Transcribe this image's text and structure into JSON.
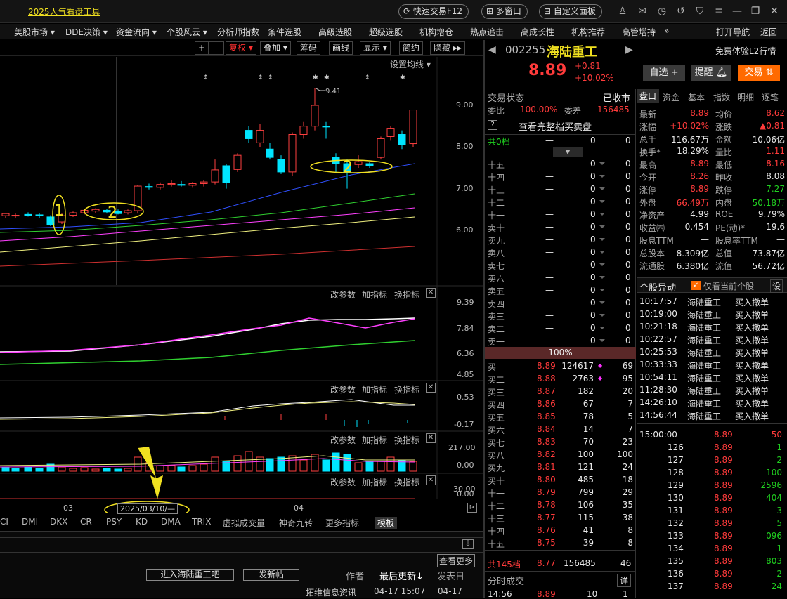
{
  "app": {
    "title_link": "2025人气看盘工具",
    "quick_trade": "快速交易F12",
    "multi_window": "多窗口",
    "custom_panel": "自定义面板"
  },
  "menu": [
    "美股市场 ▾",
    "DDE决策 ▾",
    "资金流向 ▾",
    "个股风云 ▾",
    "分析师指数",
    "条件选股",
    "高级选股",
    "超级选股",
    "机构增仓",
    "热点追击",
    "高成长性",
    "机构推荐",
    "高管增持",
    "»",
    "打开导航",
    "返回"
  ],
  "toolbar": {
    "plus": "+",
    "minus": "—",
    "fuquan": "复权 ▾",
    "overlay": "叠加 ▾",
    "chouma": "筹码",
    "draw": "画线",
    "show": "显示 ▾",
    "simple": "简约",
    "hide": "隐藏 ▸▸"
  },
  "chart": {
    "ma_setting": "设置均线 ▾",
    "high_label": "9.41",
    "price_ticks": [
      "9.00",
      "8.00",
      "7.00",
      "6.00"
    ],
    "marks": [
      "1",
      "2",
      "2"
    ],
    "ind1": {
      "ticks": [
        "9.39",
        "7.84",
        "6.36",
        "4.85"
      ]
    },
    "ind2": {
      "ticks": [
        "0.53",
        "-0.17"
      ]
    },
    "ind3": {
      "ticks": [
        "217.00",
        "0.00"
      ]
    },
    "ind4": {
      "ticks": [
        "30.00",
        "0.00"
      ]
    },
    "controls": {
      "params": "改参数",
      "add": "加指标",
      "swap": "换指标"
    },
    "dates": {
      "m1": "03",
      "m2": "04",
      "cursor": "2025/03/10/—"
    }
  },
  "indicator_tabs": [
    "CI",
    "DMI",
    "DKX",
    "CR",
    "PSY",
    "KD",
    "DMA",
    "TRIX",
    "虚拟成交量",
    "神奇九转",
    "更多指标",
    "模板"
  ],
  "bottom": {
    "more": "查看更多",
    "forum_btn": "进入海陆重工吧",
    "post_btn": "发新帖",
    "author_col": "作者",
    "last_update": "最后更新↓",
    "reply_col": "发表日",
    "source": "拓维信息资讯",
    "time": "04-17 15:07",
    "date": "04-17"
  },
  "stock": {
    "code": "002255",
    "name": "海陆重工",
    "price": "8.89",
    "change": "+0.81",
    "pct": "+10.02%",
    "l2": "免费体验L2行情",
    "btn_watch": "自选 +",
    "btn_alert": "提醒",
    "btn_trade": "交易"
  },
  "status": {
    "label": "交易状态",
    "value": "已收市",
    "weibi_label": "委比",
    "weibi": "100.00%",
    "weicha_label": "委差",
    "weicha": "156485",
    "full": "查看完整档买卖盘",
    "q": "?"
  },
  "sell_head": {
    "label": "共0档",
    "dash": "—",
    "v1": "0",
    "v2": "0"
  },
  "sells": [
    [
      "十五",
      "—",
      "0",
      "0"
    ],
    [
      "十四",
      "—",
      "0",
      "0"
    ],
    [
      "十三",
      "—",
      "0",
      "0"
    ],
    [
      "十二",
      "—",
      "0",
      "0"
    ],
    [
      "十一",
      "—",
      "0",
      "0"
    ],
    [
      "卖十",
      "—",
      "0",
      "0"
    ],
    [
      "卖九",
      "—",
      "0",
      "0"
    ],
    [
      "卖八",
      "—",
      "0",
      "0"
    ],
    [
      "卖七",
      "—",
      "0",
      "0"
    ],
    [
      "卖六",
      "—",
      "0",
      "0"
    ],
    [
      "卖五",
      "—",
      "0",
      "0"
    ],
    [
      "卖四",
      "—",
      "0",
      "0"
    ],
    [
      "卖三",
      "—",
      "0",
      "0"
    ],
    [
      "卖二",
      "—",
      "0",
      "0"
    ],
    [
      "卖一",
      "—",
      "0",
      "0"
    ]
  ],
  "ratio": "100%",
  "buys": [
    [
      "买一",
      "8.89",
      "124617",
      "69"
    ],
    [
      "买二",
      "8.88",
      "2763",
      "95"
    ],
    [
      "买三",
      "8.87",
      "182",
      "20"
    ],
    [
      "买四",
      "8.86",
      "67",
      "7"
    ],
    [
      "买五",
      "8.85",
      "78",
      "5"
    ],
    [
      "买六",
      "8.84",
      "14",
      "7"
    ],
    [
      "买七",
      "8.83",
      "70",
      "23"
    ],
    [
      "买八",
      "8.82",
      "100",
      "100"
    ],
    [
      "买九",
      "8.81",
      "121",
      "24"
    ],
    [
      "买十",
      "8.80",
      "485",
      "18"
    ],
    [
      "十一",
      "8.79",
      "799",
      "29"
    ],
    [
      "十二",
      "8.78",
      "106",
      "35"
    ],
    [
      "十三",
      "8.77",
      "115",
      "38"
    ],
    [
      "十四",
      "8.76",
      "41",
      "8"
    ],
    [
      "十五",
      "8.75",
      "39",
      "8"
    ]
  ],
  "buy_total": {
    "label": "共145档",
    "price": "8.77",
    "vol": "156485",
    "n": "46"
  },
  "ticks_head": {
    "label": "分时成交",
    "more": "详"
  },
  "tick_rows": [
    [
      "14:56",
      "8.89",
      "10",
      "1"
    ]
  ],
  "tabs": [
    "盘口",
    "资金",
    "基本",
    "指数",
    "明细",
    "逐笔"
  ],
  "quote": [
    [
      "最新",
      "8.89",
      "均价",
      "8.62"
    ],
    [
      "涨幅",
      "+10.02%",
      "涨跌",
      "▲0.81"
    ],
    [
      "总手",
      "116.67万",
      "金额",
      "10.06亿"
    ],
    [
      "换手*",
      "18.29%",
      "量比",
      "1.11"
    ],
    [
      "最高",
      "8.89",
      "最低",
      "8.16"
    ],
    [
      "今开",
      "8.26",
      "昨收",
      "8.08"
    ],
    [
      "涨停",
      "8.89",
      "跌停",
      "7.27"
    ],
    [
      "外盘",
      "66.49万",
      "内盘",
      "50.18万"
    ],
    [
      "净资产",
      "4.99",
      "ROE",
      "9.79%"
    ],
    [
      "收益㈣",
      "0.454",
      "PE(动)*",
      "19.6"
    ],
    [
      "股息TTM",
      "—",
      "股息率TTM",
      "—"
    ],
    [
      "总股本",
      "8.309亿",
      "总值",
      "73.87亿"
    ],
    [
      "流通股",
      "6.380亿",
      "流值",
      "56.72亿"
    ]
  ],
  "alerts": {
    "title": "个股异动",
    "only": "仅看当前个股",
    "settings": "设",
    "rows": [
      [
        "10:17:57",
        "海陆重工",
        "买入撤单"
      ],
      [
        "10:19:00",
        "海陆重工",
        "买入撤单"
      ],
      [
        "10:21:18",
        "海陆重工",
        "买入撤单"
      ],
      [
        "10:22:57",
        "海陆重工",
        "买入撤单"
      ],
      [
        "10:25:53",
        "海陆重工",
        "买入撤单"
      ],
      [
        "10:33:33",
        "海陆重工",
        "买入撤单"
      ],
      [
        "10:54:11",
        "海陆重工",
        "买入撤单"
      ],
      [
        "11:28:30",
        "海陆重工",
        "买入撤单"
      ],
      [
        "14:26:10",
        "海陆重工",
        "买入撤单"
      ],
      [
        "14:56:44",
        "海陆重工",
        "买入撤单"
      ]
    ]
  },
  "trades": [
    [
      "15:00:00",
      "8.89",
      "50"
    ],
    [
      "126",
      "8.89",
      "1"
    ],
    [
      "127",
      "8.89",
      "2"
    ],
    [
      "128",
      "8.89",
      "100"
    ],
    [
      "129",
      "8.89",
      "2596"
    ],
    [
      "130",
      "8.89",
      "404"
    ],
    [
      "131",
      "8.89",
      "3"
    ],
    [
      "132",
      "8.89",
      "5"
    ],
    [
      "133",
      "8.89",
      "096"
    ],
    [
      "134",
      "8.89",
      "1"
    ],
    [
      "135",
      "8.89",
      "803"
    ],
    [
      "136",
      "8.89",
      "2"
    ],
    [
      "137",
      "8.89",
      "24"
    ]
  ],
  "colors": {
    "up": "#ff3b3b",
    "down": "#20d020",
    "cyan": "#00e5ff",
    "yellow": "#f0e020",
    "accent": "#ff6a00"
  }
}
